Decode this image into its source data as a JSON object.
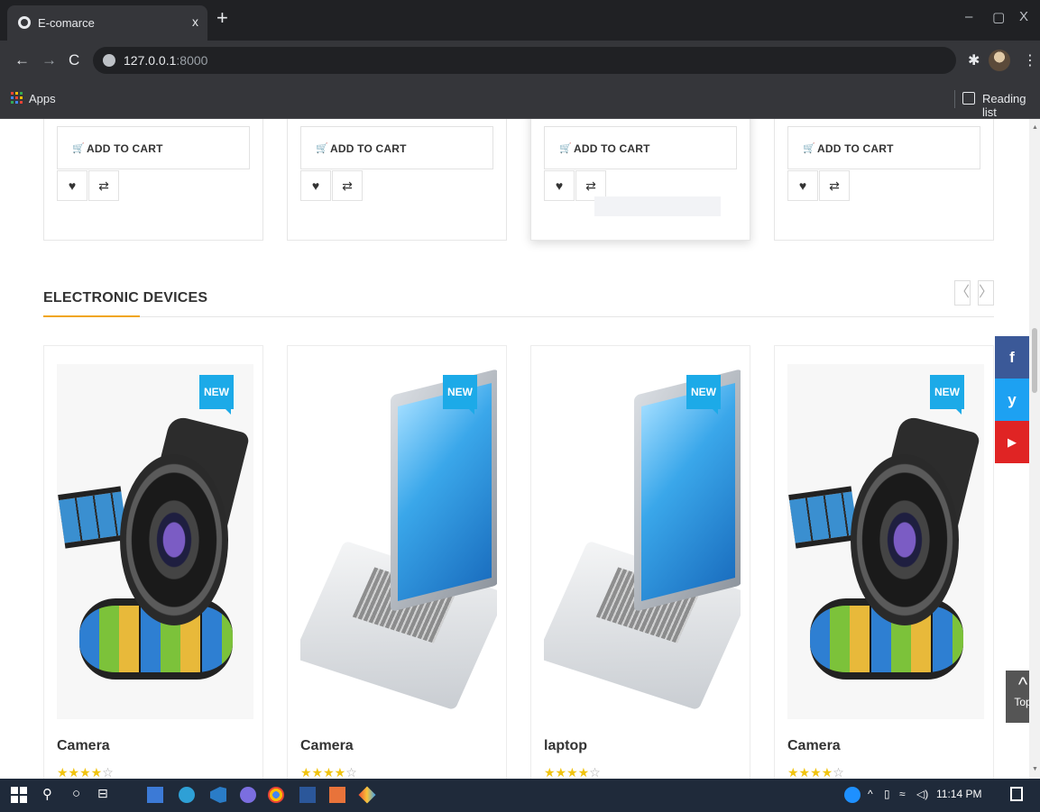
{
  "browser": {
    "tab_title": "E-comarce",
    "tab_close": "x",
    "new_tab": "+",
    "minimize": "–",
    "restore": "▢",
    "close": "X",
    "url_host": "127.0.0.1",
    "url_port": ":8000",
    "bookmarks": {
      "apps_label": "Apps",
      "reading_list_label": "Reading list"
    }
  },
  "top_row": {
    "add_to_cart_label": "ADD TO CART",
    "cards": [
      "card-1",
      "card-2",
      "card-3",
      "card-4"
    ]
  },
  "section": {
    "title": "ELECTRONIC DEVICES",
    "prev": "〈",
    "next": "〉",
    "accent_color": "#f1a516"
  },
  "products": [
    {
      "name": "Camera",
      "badge": "NEW",
      "stars_on": "★★★★",
      "stars_off": "☆",
      "image": "camera"
    },
    {
      "name": "Camera",
      "badge": "NEW",
      "stars_on": "★★★★",
      "stars_off": "☆",
      "image": "laptop"
    },
    {
      "name": "laptop",
      "badge": "NEW",
      "stars_on": "★★★★",
      "stars_off": "☆",
      "image": "laptop"
    },
    {
      "name": "Camera",
      "badge": "NEW",
      "stars_on": "★★★★",
      "stars_off": "☆",
      "image": "camera"
    }
  ],
  "social": {
    "facebook": "f",
    "twitter": "y",
    "youtube": "▶",
    "colors": {
      "facebook": "#3b5998",
      "twitter": "#1da1f2",
      "youtube": "#e02424"
    }
  },
  "top_button": {
    "chevron": "^",
    "label": "Top"
  },
  "taskbar": {
    "time": "11:14 PM"
  }
}
